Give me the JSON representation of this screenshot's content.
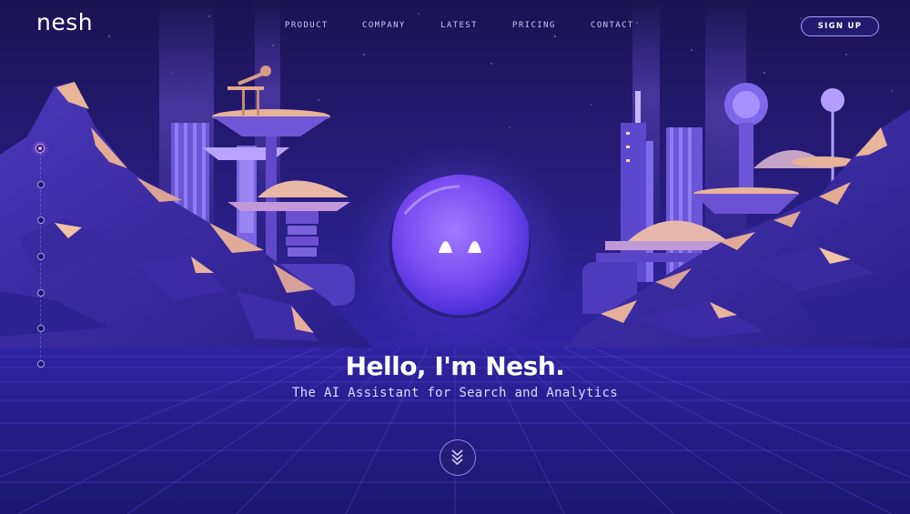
{
  "brand": {
    "logo_text": "nesh"
  },
  "nav": {
    "items": [
      {
        "label": "PRODUCT"
      },
      {
        "label": "COMPANY"
      },
      {
        "label": "LATEST"
      },
      {
        "label": "PRICING"
      },
      {
        "label": "CONTACT"
      }
    ],
    "signup_label": "SIGN UP"
  },
  "side_nav": {
    "dot_count": 7,
    "active_index": 0
  },
  "hero": {
    "headline": "Hello, I'm Nesh.",
    "subhead": "The AI Assistant for Search and Analytics",
    "scroll_icon": "chevron-double-down-icon"
  },
  "colors": {
    "background": "#1a1460",
    "accent": "#7b5cff",
    "rock_highlight": "#e6b89a",
    "text": "#ffffff"
  }
}
